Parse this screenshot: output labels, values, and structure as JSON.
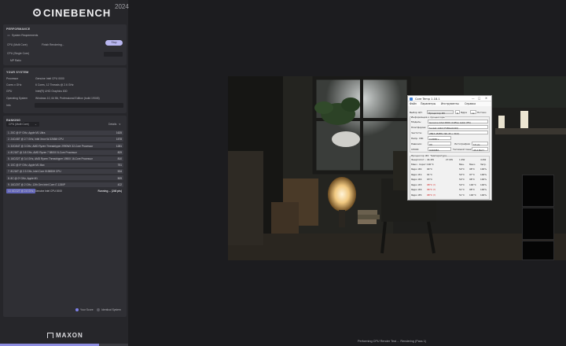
{
  "app": {
    "name": "CINEBENCH",
    "year": "2024"
  },
  "performance": {
    "title": "PERFORMANCE",
    "system_requirements": "System Requirements",
    "cpu_multi_label": "CPU (Multi Core)",
    "cpu_multi_status": "Finish Rendering...",
    "stop_label": "Stop",
    "cpu_single_label": "CPU (Single Core)",
    "mp_ratio_label": "MP Ratio"
  },
  "your_system": {
    "title": "YOUR SYSTEM",
    "rows": [
      {
        "label": "Processor",
        "value": "Genuine Intel CPU 0000"
      },
      {
        "label": "Cores x GHz",
        "value": "6 Cores, 12 Threads @ 2.6 GHz"
      },
      {
        "label": "GPU",
        "value": "Intel(R) UHD Graphics 630"
      },
      {
        "label": "Operating System",
        "value": "Windows 10, 64 Bit, Professional Edition (build 19045)"
      },
      {
        "label": "Info",
        "value": ""
      }
    ]
  },
  "ranking": {
    "title": "RANKING",
    "selector": "CPU (Multi Core)",
    "details_label": "Details",
    "rows": [
      {
        "label": "1. 20C @ 0* GHz, Apple M1 Ultra",
        "value": "1625"
      },
      {
        "label": "2. 24C/48T @ 2.7 GHz, Intel Xeon W-3265M CPU",
        "value": "1578"
      },
      {
        "label": "3. 32C/64T @ 3 GHz, AMD Ryzen Threadripper 2990WX 32-Core Processor",
        "value": "1281"
      },
      {
        "label": "4. 8C/16T @ 3.8 GHz, AMD Ryzen 7 5800X 8-Core Processor",
        "value": "829"
      },
      {
        "label": "5. 16C/32T @ 3.4 GHz, AMD Ryzen Threadripper 1950X 16-Core Processor",
        "value": "810"
      },
      {
        "label": "6. 10C @ 0* GHz, Apple M1 Max",
        "value": "751"
      },
      {
        "label": "7. 8C/16T @ 2.3 GHz, Intel Core i9-9880H CPU",
        "value": "534"
      },
      {
        "label": "8. 8C @ 0* GHz, Apple M1",
        "value": "509"
      },
      {
        "label": "9. 16C/20T @ 2 GHz, 12th Gen Intel Core i7-1280P",
        "value": "422"
      },
      {
        "label": "10. 6C/12T @ 2.6 GHz, Genuine Intel CPU 0000",
        "value": "Running ... (246 pts)"
      }
    ],
    "running_progress": 0.25,
    "legend_your_score": "Your Score",
    "legend_identical": "Identical System"
  },
  "footer": {
    "brand": "MAXON",
    "status": "Performing CPU Render Test ... Rendering (Pass 1)",
    "progress": 0.77
  },
  "core_temp": {
    "title": "Core Temp 1.18.1",
    "controls": [
      "—",
      "□",
      "✕"
    ],
    "menu": [
      "Файл",
      "Параметры",
      "Инструменты",
      "Справка"
    ],
    "select_cpu_label": "Выбор ЦП:",
    "select_cpu_value": "Процессор #0",
    "cores_label": "6",
    "cores_suffix": "Ядра",
    "threads_label": "12",
    "threads_suffix": "Потоки",
    "info_header": "Информация о процессоре",
    "rows": [
      {
        "label": "Модель:",
        "value": "Genuine Intel 0000 (Coffee Lake) (ES)"
      },
      {
        "label": "Платформа:",
        "value": "Socket 1440 (FCBGA1440)"
      },
      {
        "label": "Частота:",
        "value": "2893.45MHz (96.45 x 30.0)"
      },
      {
        "label": "Напр. VID:",
        "value": "0.9588 v"
      }
    ],
    "revision_label": "Ревизия:",
    "revision_value": "U0",
    "lithography_label": "Литография:",
    "lithography_value": "14 нм",
    "cpuid_label": "CPUID:",
    "cpuid_value": "0x906EA",
    "tdp_label": "Тепловой пакет:",
    "tdp_value": "45.0 Ватт",
    "temp_header": "Процессор #0: Температура",
    "temp_cols": [
      "Мин.",
      "Макс.",
      "Загр."
    ],
    "power_label": "Энергопот.:",
    "power_values": [
      "44.4W",
      "27.0W",
      "1.9W",
      "4.9W"
    ],
    "tjmax_label": "Макс. порог:",
    "tjmax_value": "100°C",
    "cores": [
      {
        "label": "Ядро #0:",
        "value": "94°C",
        "min": "50°C",
        "max": "98°C",
        "load": "100%"
      },
      {
        "label": "Ядро #1:",
        "value": "91°C",
        "min": "50°C",
        "max": "97°C",
        "load": "100%"
      },
      {
        "label": "Ядро #2:",
        "value": "93°C",
        "min": "50°C",
        "max": "98°C",
        "load": "100%"
      },
      {
        "label": "Ядро #3:",
        "value": "98°C (!)",
        "min": "50°C",
        "max": "100°C",
        "load": "100%"
      },
      {
        "label": "Ядро #4:",
        "value": "96°C (!)",
        "min": "51°C",
        "max": "98°C",
        "load": "100%"
      },
      {
        "label": "Ядро #5:",
        "value": "98°C (!)",
        "min": "51°C",
        "max": "100°C",
        "load": "100%"
      }
    ]
  },
  "colors": {
    "accent": "#b9b7f0",
    "running_bar": "#6265b8",
    "legend_your_score": "#7d80e8",
    "legend_identical": "#5a5a62",
    "temp_hot": "#d01010"
  }
}
